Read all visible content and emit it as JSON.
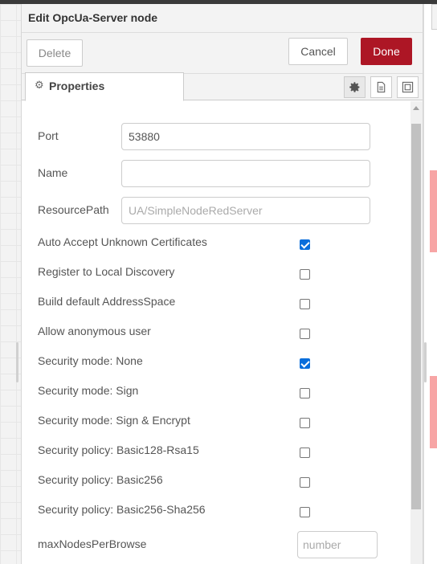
{
  "tray": {
    "title": "Edit OpcUa-Server node",
    "delete_label": "Delete",
    "cancel_label": "Cancel",
    "done_label": "Done"
  },
  "tabs": {
    "properties_label": "Properties",
    "properties_icon": "gear-icon"
  },
  "toolbar_icons": [
    "gear-icon",
    "document-icon",
    "frame-icon"
  ],
  "form": {
    "port_label": "Port",
    "port_value": "53880",
    "name_label": "Name",
    "name_value": "",
    "resource_label": "ResourcePath",
    "resource_placeholder": "UA/SimpleNodeRedServer",
    "checkboxes": [
      {
        "label": "Auto Accept Unknown Certificates",
        "checked": true
      },
      {
        "label": "Register to Local Discovery",
        "checked": false
      },
      {
        "label": "Build default AddressSpace",
        "checked": false
      },
      {
        "label": "Allow anonymous user",
        "checked": false
      },
      {
        "label": "Security mode: None",
        "checked": true
      },
      {
        "label": "Security mode: Sign",
        "checked": false
      },
      {
        "label": "Security mode: Sign & Encrypt",
        "checked": false
      },
      {
        "label": "Security policy: Basic128-Rsa15",
        "checked": false
      },
      {
        "label": "Security policy: Basic256",
        "checked": false
      },
      {
        "label": "Security policy: Basic256-Sha256",
        "checked": false
      }
    ],
    "max_nodes_label": "maxNodesPerBrowse",
    "max_nodes_placeholder": "number"
  },
  "colors": {
    "done_button": "#ad1625",
    "checkbox_checked": "#0a6edb"
  }
}
